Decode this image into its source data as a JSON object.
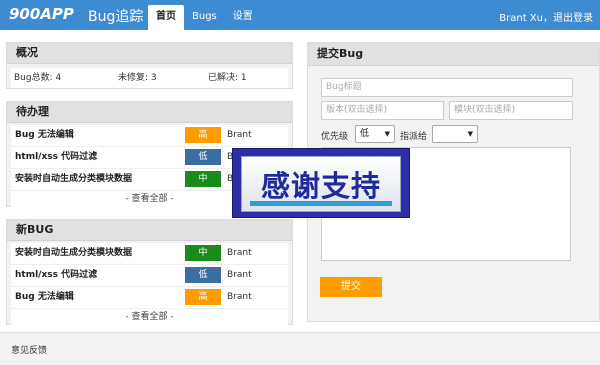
{
  "header": {
    "logo": "900APP",
    "app_name": "Bug追踪",
    "tabs": [
      "首页",
      "Bugs",
      "设置"
    ],
    "user": "Brant Xu",
    "logout": "，退出登录"
  },
  "overview": {
    "title": "概况",
    "total": "Bug总数: 4",
    "unfixed": "未修复: 3",
    "resolved": "已解决: 1"
  },
  "todo": {
    "title": "待办理",
    "rows": [
      {
        "title": "Bug 无法编辑",
        "priority": "高",
        "color": "#ff9c00",
        "owner": "Brant"
      },
      {
        "title": "html/xss 代码过滤",
        "priority": "低",
        "color": "#3a6ea5",
        "owner": "B"
      },
      {
        "title": "安装时自动生成分类模块数据",
        "priority": "中",
        "color": "#1a8a1a",
        "owner": "B"
      }
    ],
    "view_all": "- 查看全部 -"
  },
  "newbug": {
    "title": "新BUG",
    "rows": [
      {
        "title": "安装时自动生成分类模块数据",
        "priority": "中",
        "color": "#1a8a1a",
        "owner": "Brant"
      },
      {
        "title": "html/xss 代码过滤",
        "priority": "低",
        "color": "#3a6ea5",
        "owner": "Brant"
      },
      {
        "title": "Bug 无法编辑",
        "priority": "高",
        "color": "#ff9c00",
        "owner": "Brant"
      }
    ],
    "view_all": "- 查看全部 -"
  },
  "submit": {
    "title": "提交Bug",
    "title_placeholder": "Bug标题",
    "version_placeholder": "版本(双击选择)",
    "module_placeholder": "模块(双击选择)",
    "priority_label": "优先级",
    "priority_value": "低",
    "assign_label": "指派给",
    "assign_value": "",
    "button": "提交"
  },
  "footer": {
    "feedback": "意见反馈"
  },
  "overlay": {
    "text": "感谢支持"
  }
}
